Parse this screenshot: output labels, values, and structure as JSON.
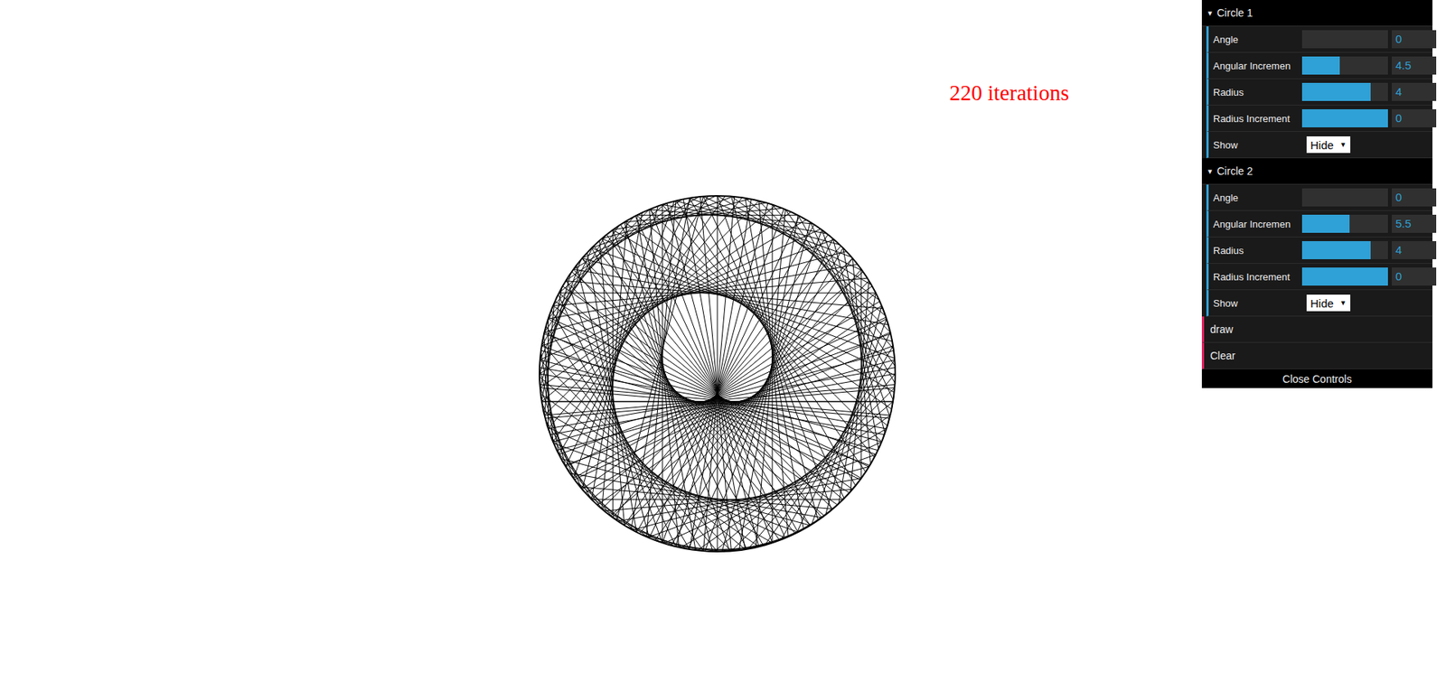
{
  "status": {
    "text": "220 iterations"
  },
  "controls": {
    "folders": [
      {
        "title": "Circle 1",
        "arrow": "▾",
        "expanded": true,
        "rows": [
          {
            "kind": "slider",
            "label": "Angle",
            "value": "0",
            "level": 0
          },
          {
            "kind": "slider",
            "label": "Angular Incremen",
            "value": "4.5",
            "level": 0.44
          },
          {
            "kind": "slider",
            "label": "Radius",
            "value": "4",
            "level": 0.8
          },
          {
            "kind": "slider",
            "label": "Radius Increment",
            "value": "0",
            "level": 1
          },
          {
            "kind": "select",
            "label": "Show",
            "value": "Hide",
            "arrow": "▼"
          }
        ]
      },
      {
        "title": "Circle 2",
        "arrow": "▾",
        "expanded": true,
        "rows": [
          {
            "kind": "slider",
            "label": "Angle",
            "value": "0",
            "level": 0
          },
          {
            "kind": "slider",
            "label": "Angular Incremen",
            "value": "5.5",
            "level": 0.55
          },
          {
            "kind": "slider",
            "label": "Radius",
            "value": "4",
            "level": 0.8
          },
          {
            "kind": "slider",
            "label": "Radius Increment",
            "value": "0",
            "level": 1
          },
          {
            "kind": "select",
            "label": "Show",
            "value": "Hide",
            "arrow": "▼"
          }
        ]
      }
    ],
    "buttons": [
      {
        "label": "draw"
      },
      {
        "label": "Clear"
      }
    ],
    "close": "Close Controls"
  }
}
